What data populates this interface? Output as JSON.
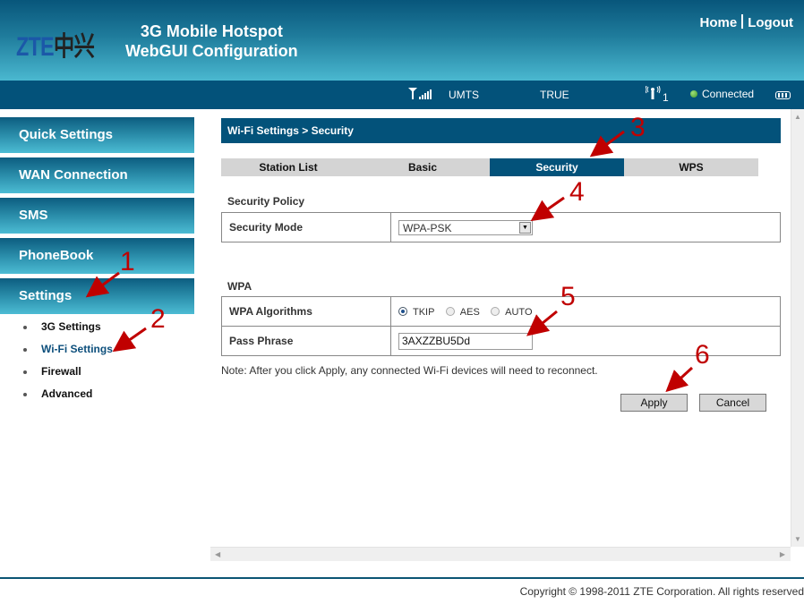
{
  "header": {
    "logo_latin": "ZTE",
    "logo_cn": "中兴",
    "title_line1": "3G Mobile Hotspot",
    "title_line2": "WebGUI Configuration",
    "home_link": "Home",
    "logout_link": "Logout"
  },
  "status": {
    "signal_icon": "signal-strength-icon",
    "network_type": "UMTS",
    "roaming": "TRUE",
    "wifi_icon": "wifi-clients-icon",
    "wifi_clients": "1",
    "connection": "Connected",
    "connection_color": "#4caf3a",
    "battery_icon": "battery-icon"
  },
  "sidebar": {
    "items": [
      {
        "label": "Quick Settings"
      },
      {
        "label": "WAN Connection"
      },
      {
        "label": "SMS"
      },
      {
        "label": "PhoneBook"
      },
      {
        "label": "Settings"
      }
    ],
    "subitems": [
      {
        "label": "3G Settings"
      },
      {
        "label": "Wi-Fi Settings",
        "active": true
      },
      {
        "label": "Firewall"
      },
      {
        "label": "Advanced"
      }
    ]
  },
  "main": {
    "breadcrumb": "Wi-Fi Settings > Security",
    "tabs": [
      {
        "label": "Station List"
      },
      {
        "label": "Basic"
      },
      {
        "label": "Security",
        "active": true
      },
      {
        "label": "WPS"
      }
    ],
    "security_policy": {
      "heading": "Security Policy",
      "mode_label": "Security Mode",
      "mode_value": "WPA-PSK"
    },
    "wpa": {
      "heading": "WPA",
      "algorithms_label": "WPA Algorithms",
      "algorithms": [
        {
          "label": "TKIP",
          "selected": true
        },
        {
          "label": "AES",
          "selected": false
        },
        {
          "label": "AUTO",
          "selected": false
        }
      ],
      "passphrase_label": "Pass Phrase",
      "passphrase_value": "3AXZZBU5Dd"
    },
    "note": "Note: After you click Apply, any connected Wi-Fi devices will need to reconnect.",
    "apply_label": "Apply",
    "cancel_label": "Cancel"
  },
  "annotations": [
    "1",
    "2",
    "3",
    "4",
    "5",
    "6"
  ],
  "annotation_color": "#c00000",
  "footer": {
    "copyright": "Copyright © 1998-2011 ZTE Corporation. All rights reserved"
  }
}
